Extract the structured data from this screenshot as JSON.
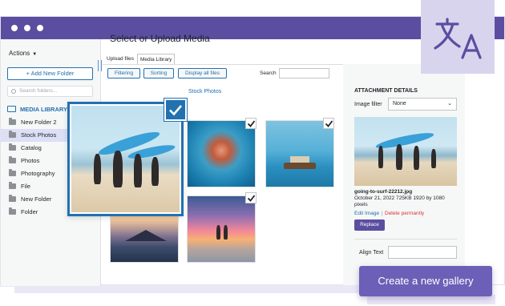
{
  "sidebar": {
    "actions_label": "Actions",
    "add_folder_label": "+ Add New Folder",
    "search_placeholder": "Search folders...",
    "library_label": "MEDIA LIBRARY",
    "folders": [
      {
        "label": "New Folder 2"
      },
      {
        "label": "Stock Photos",
        "active": true
      },
      {
        "label": "Catalog"
      },
      {
        "label": "Photos"
      },
      {
        "label": "Photography"
      },
      {
        "label": "File"
      },
      {
        "label": "New Folder"
      },
      {
        "label": "Folder"
      }
    ]
  },
  "main": {
    "title": "Select or Upload Media",
    "tabs": [
      {
        "label": "Upload files"
      },
      {
        "label": "Media Library",
        "active": true
      }
    ],
    "toolbar": {
      "filtering_label": "Filtering",
      "sorting_label": "Sorting",
      "display_all_label": "Display all files",
      "search_label": "Search"
    },
    "breadcrumb": "Stock Photos"
  },
  "details": {
    "title": "ATTACHMENT DETAILS",
    "filter_label": "Image filter",
    "filter_value": "None",
    "file_name": "going-to-surf-22212.jpg",
    "file_meta": "October 21, 2022 725KB 1920 by 1080 pixels",
    "edit_label": "Edit Image",
    "separator": "|",
    "delete_label": "Delete permantly",
    "replace_label": "Replace",
    "align_label": "Align Text"
  },
  "cta_label": "Create a new gallery",
  "colors": {
    "brand": "#5b4ea0",
    "accent": "#2271b1",
    "danger": "#d63638",
    "cta": "#6c5fb7"
  }
}
